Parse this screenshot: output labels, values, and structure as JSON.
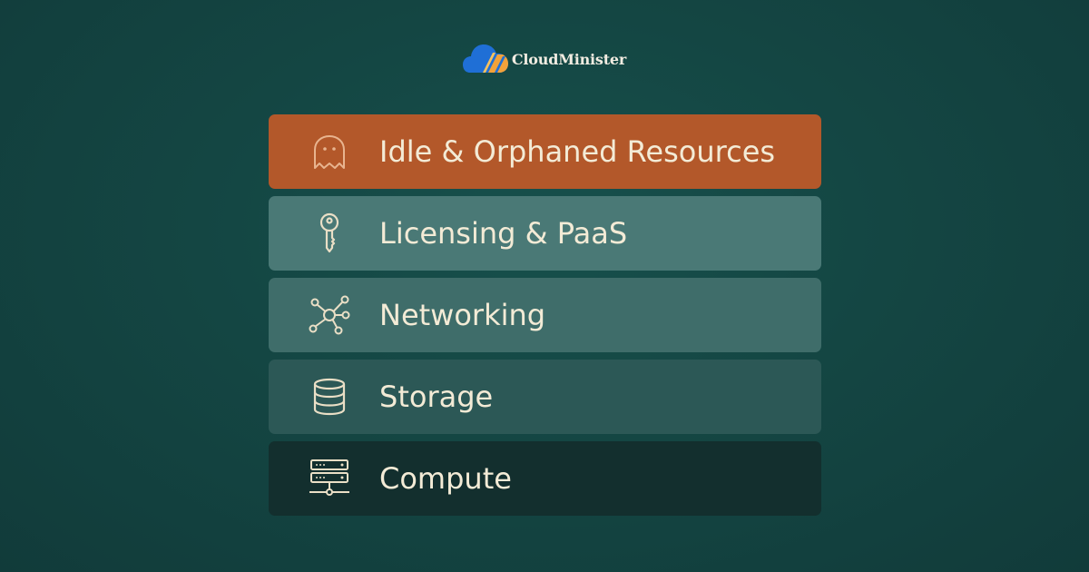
{
  "brand": {
    "name": "CloudMinister",
    "logo_icon": "cloud-logo-icon",
    "colors": {
      "cloud_blue": "#1f6fd6",
      "cloud_orange": "#f2a23a"
    }
  },
  "categories": [
    {
      "label": "Idle & Orphaned Resources",
      "icon": "ghost-icon",
      "color": "#b3582a"
    },
    {
      "label": "Licensing & PaaS",
      "icon": "key-icon",
      "color": "#4a7976"
    },
    {
      "label": "Networking",
      "icon": "network-icon",
      "color": "#3f6d6a"
    },
    {
      "label": "Storage",
      "icon": "database-icon",
      "color": "#2c5856"
    },
    {
      "label": "Compute",
      "icon": "server-icon",
      "color": "#132f2e"
    }
  ],
  "theme": {
    "background": "#144643",
    "text": "#f3ebd6",
    "icon_stroke": "#eadfc6"
  }
}
